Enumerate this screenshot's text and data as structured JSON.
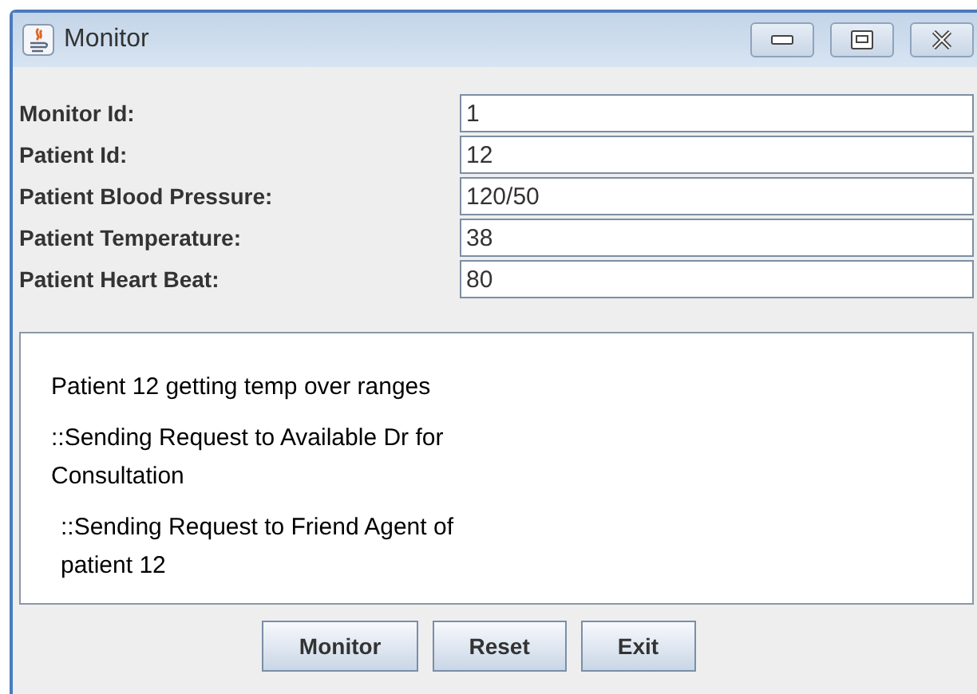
{
  "window": {
    "title": "Monitor"
  },
  "fields": [
    {
      "label": "Monitor Id:",
      "value": "1"
    },
    {
      "label": "Patient Id:",
      "value": "12"
    },
    {
      "label": "Patient Blood Pressure:",
      "value": "120/50"
    },
    {
      "label": "Patient Temperature:",
      "value": "38"
    },
    {
      "label": "Patient Heart Beat:",
      "value": "80"
    }
  ],
  "messages": [
    {
      "text": "Patient 12 getting temp over ranges",
      "indented": false
    },
    {
      "text": "::Sending Request to Available Dr for Consultation",
      "indented": false
    },
    {
      "text": "::Sending Request to Friend Agent of patient 12",
      "indented": true
    }
  ],
  "buttons": [
    "Monitor",
    "Reset",
    "Exit"
  ]
}
